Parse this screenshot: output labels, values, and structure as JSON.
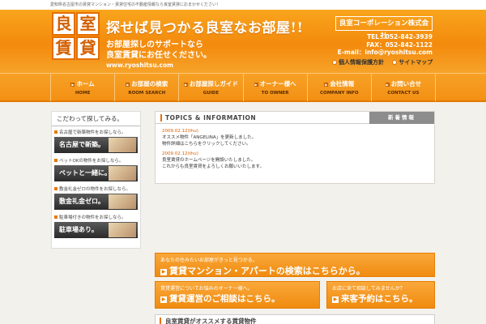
{
  "top_text": "愛知県名古屋市の賃貸マンション・賃貸住宅の不動産情報なら良室賃貸におまかせください！",
  "logo": [
    "良",
    "室",
    "賃",
    "貸"
  ],
  "header": {
    "catch": "探せば見つかる良室なお部屋!!",
    "sub1": "お部屋探しのサポートなら",
    "sub2": "良室賃貸にお任せください。",
    "url": "www.ryoshitsu.com",
    "company": "良室コーポレーション株式会社",
    "tel": "TEL：052-842-3939",
    "fax": "FAX：052-842-1122",
    "email": "E-mail：info@ryoshitsu.com",
    "links": [
      "個人情報保護方針",
      "サイトマップ"
    ]
  },
  "nav": [
    {
      "jp": "ホーム",
      "en": "HOME"
    },
    {
      "jp": "お部屋の検索",
      "en": "ROOM SEARCH"
    },
    {
      "jp": "お部屋探しガイド",
      "en": "GUIDE"
    },
    {
      "jp": "オーナー様へ",
      "en": "TO OWNER"
    },
    {
      "jp": "会社情報",
      "en": "COMPANY INFO"
    },
    {
      "jp": "お問い合せ",
      "en": "CONTACT US"
    }
  ],
  "sidebar": {
    "title": "こだわって探してみる。",
    "items": [
      {
        "cap": "名古屋で新築物件をお探しなら。",
        "label": "名古屋で新築。"
      },
      {
        "cap": "ペットOKの物件をお探しなら。",
        "label": "ペットと一緒に。"
      },
      {
        "cap": "敷金礼金ゼロの物件をお探しなら。",
        "label": "敷金礼金ゼロ。"
      },
      {
        "cap": "駐車場付きの物件をお探しなら。",
        "label": "駐車場あり。"
      }
    ]
  },
  "topics": {
    "title": "TOPICS & INFORMATION",
    "right": "新着情報",
    "news": [
      {
        "date": "2009.02.12(thu)",
        "line1": "オススメ物件「ANGELINA」を更新しました。",
        "line2": "物件詳細はこちらをクリックしてください。"
      },
      {
        "date": "2009.02.12(thu)",
        "line1": "良室賃貸のホームページを開設いたしました。",
        "line2": "これからも良室賃貸をよろしくお願いいたします。"
      }
    ]
  },
  "banners": {
    "wide": {
      "top": "あなたの住みたいお部屋がきっと見つかる。",
      "main": "賃貸マンション・アパートの検索はこちらから。"
    },
    "left": {
      "top": "賃貸運営についてお悩みのオーナー様へ。",
      "main": "賃貸運営のご相談はこちら。"
    },
    "right": {
      "top": "お店に来て相談してみませんか？",
      "main": "来客予約はこちら。"
    }
  },
  "bottom_title": "良室賃貸がオススメする賃貸物件"
}
